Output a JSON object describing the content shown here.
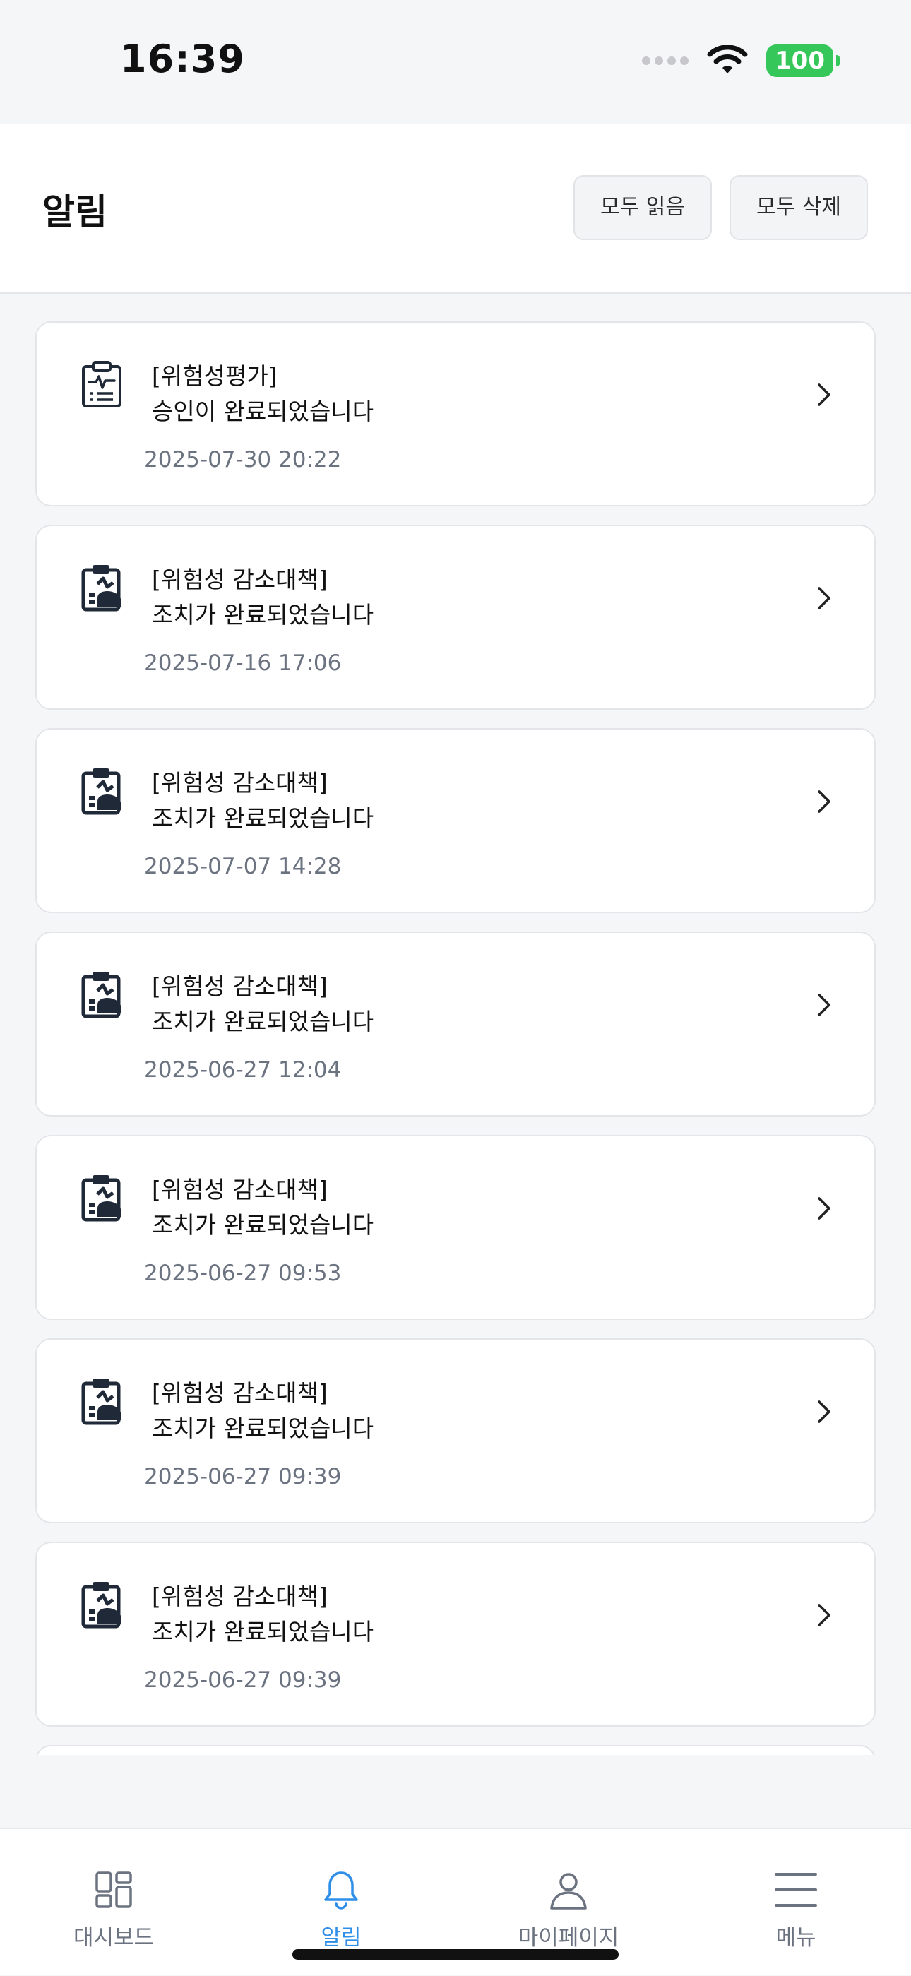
{
  "status": {
    "time": "16:39",
    "battery": "100"
  },
  "header": {
    "title": "알림",
    "mark_all_read": "모두 읽음",
    "delete_all": "모두 삭제"
  },
  "notifications": [
    {
      "icon": "clipboard-pulse-icon",
      "title": "[위험성평가]",
      "body": "승인이 완료되었습니다",
      "date": "2025-07-30 20:22"
    },
    {
      "icon": "clipboard-chart-icon",
      "title": "[위험성 감소대책]",
      "body": "조치가 완료되었습니다",
      "date": "2025-07-16 17:06"
    },
    {
      "icon": "clipboard-chart-icon",
      "title": "[위험성 감소대책]",
      "body": "조치가 완료되었습니다",
      "date": "2025-07-07 14:28"
    },
    {
      "icon": "clipboard-chart-icon",
      "title": "[위험성 감소대책]",
      "body": "조치가 완료되었습니다",
      "date": "2025-06-27 12:04"
    },
    {
      "icon": "clipboard-chart-icon",
      "title": "[위험성 감소대책]",
      "body": "조치가 완료되었습니다",
      "date": "2025-06-27 09:53"
    },
    {
      "icon": "clipboard-chart-icon",
      "title": "[위험성 감소대책]",
      "body": "조치가 완료되었습니다",
      "date": "2025-06-27 09:39"
    },
    {
      "icon": "clipboard-chart-icon",
      "title": "[위험성 감소대책]",
      "body": "조치가 완료되었습니다",
      "date": "2025-06-27 09:39"
    }
  ],
  "tabs": [
    {
      "icon": "dashboard-icon",
      "label": "대시보드",
      "active": false
    },
    {
      "icon": "bell-icon",
      "label": "알림",
      "active": true
    },
    {
      "icon": "person-icon",
      "label": "마이페이지",
      "active": false
    },
    {
      "icon": "menu-icon",
      "label": "메뉴",
      "active": false
    }
  ],
  "colors": {
    "accent": "#2f8fe8",
    "battery": "#35c759",
    "date_text": "#6b7280"
  }
}
